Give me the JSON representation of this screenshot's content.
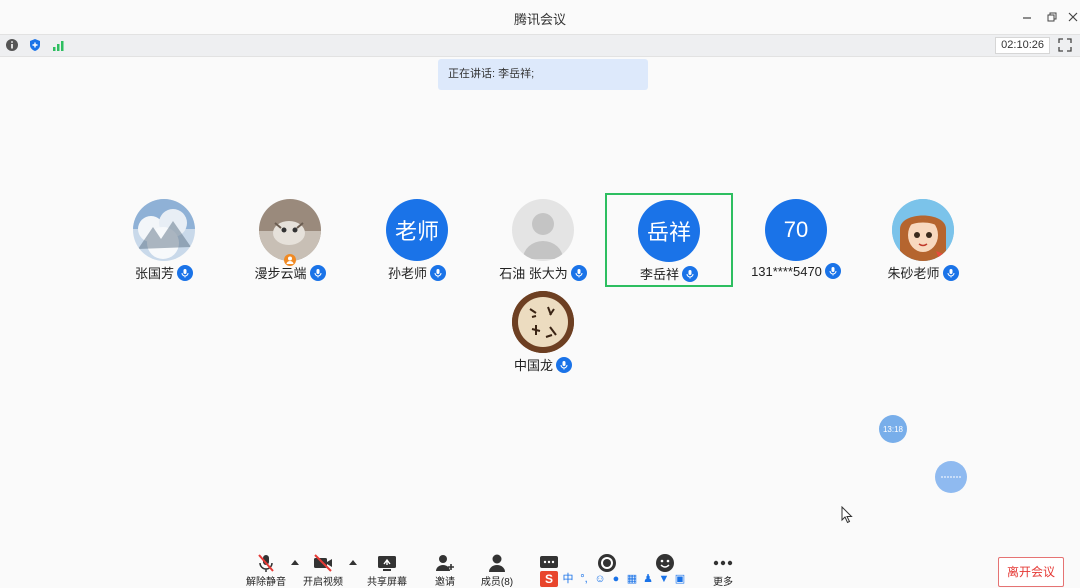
{
  "window": {
    "title": "腾讯会议"
  },
  "status": {
    "timer": "02:10:26"
  },
  "speaking_banner": "正在讲话: 李岳祥;",
  "participants": [
    {
      "name": "张国芳",
      "avatar_text": "",
      "avatar": "photo-snow"
    },
    {
      "name": "漫步云端",
      "avatar_text": "",
      "avatar": "photo-cat"
    },
    {
      "name": "孙老师",
      "avatar_text": "老师",
      "avatar": "blue"
    },
    {
      "name": "石油 张大为",
      "avatar_text": "",
      "avatar": "default-person"
    },
    {
      "name": "李岳祥",
      "avatar_text": "岳祥",
      "avatar": "blue",
      "active": true
    },
    {
      "name": "131****5470",
      "avatar_text": "70",
      "avatar": "blue"
    },
    {
      "name": "朱砂老师",
      "avatar_text": "",
      "avatar": "cartoon-girl"
    },
    {
      "name": "中国龙",
      "avatar_text": "",
      "avatar": "calligraphy"
    }
  ],
  "floating": {
    "bubble_time": "13:18",
    "bubble2": ""
  },
  "toolbar": {
    "unmute": "解除静音",
    "start_video": "开启视频",
    "share_screen": "共享屏幕",
    "invite": "邀请",
    "members": "成员(8)",
    "more": "更多"
  },
  "leave_button": "离开会议",
  "ime": {
    "logo": "S",
    "lang": "中"
  },
  "colors": {
    "accent": "#1a73e8",
    "active_border": "#2dbe60",
    "leave": "#e53935"
  }
}
